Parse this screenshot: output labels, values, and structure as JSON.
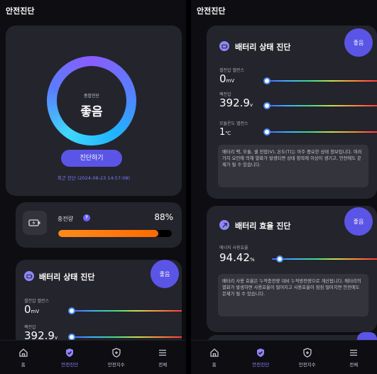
{
  "left": {
    "header": {
      "title": "안전진단"
    },
    "diagnosis": {
      "ring_label": "종합진단",
      "ring_value": "좋음",
      "button_label": "진단하기",
      "last_diagnosis": "최근 진단 (2024-08-23 14:57:08)"
    },
    "charge": {
      "label": "충전량",
      "help": "?",
      "percent_text": "88%",
      "percent": 88
    },
    "battery_state": {
      "title": "배터리 상태 진단",
      "badge": "좋음",
      "metrics": [
        {
          "label": "셀전압 밸런스",
          "value": "0",
          "unit": "mV",
          "level": 0
        },
        {
          "label": "팩전압",
          "value": "392.9",
          "unit": "v",
          "level": 0
        }
      ]
    }
  },
  "right": {
    "header": {
      "title": "안전진단"
    },
    "battery_state": {
      "title": "배터리 상태 진단",
      "badge": "좋음",
      "metrics": [
        {
          "label": "셀전압 밸런스",
          "value": "0",
          "unit": "mV",
          "level": 0
        },
        {
          "label": "팩전압",
          "value": "392.9",
          "unit": "v",
          "level": 0
        },
        {
          "label": "모듈온도 밸런스",
          "value": "1",
          "unit": "℃",
          "level": 0
        }
      ],
      "description": "배터리 팩, 모듈, 셀 전압(V), 온도(T)는 아주 중요한 상태 정보입니다. 여러가지 요인에 의해 열화가 발생되면 상태 항목에 이상이 생기고, 안전에도 문제가 될 수 있습니다."
    },
    "battery_efficiency": {
      "title": "배터리 효율 진단",
      "badge": "좋음",
      "metric": {
        "label": "에너지 사용효율",
        "value": "94.42",
        "unit": "%",
        "level": 0
      },
      "description": "배터리 사용 효율은 누적충전량 대비 누적방전량으로 계산됩니다. 배터리의 열화가 발생하면 사용효율이 떨어지고 사용효율이 점점 떨어지면 안전에도 문제가 될 수 있습니다."
    }
  },
  "nav": [
    {
      "label": "홈",
      "icon": "home-icon",
      "active": false
    },
    {
      "label": "안전진단",
      "icon": "shield-check-icon",
      "active": true
    },
    {
      "label": "안전지수",
      "icon": "shield-plus-icon",
      "active": false
    },
    {
      "label": "전체",
      "icon": "menu-icon",
      "active": false
    }
  ],
  "colors": {
    "accent": "#5a55e6",
    "accent_light": "#8f87ff",
    "charge": "#ff7a00",
    "card": "#24242c",
    "background": "#0d0d12"
  }
}
